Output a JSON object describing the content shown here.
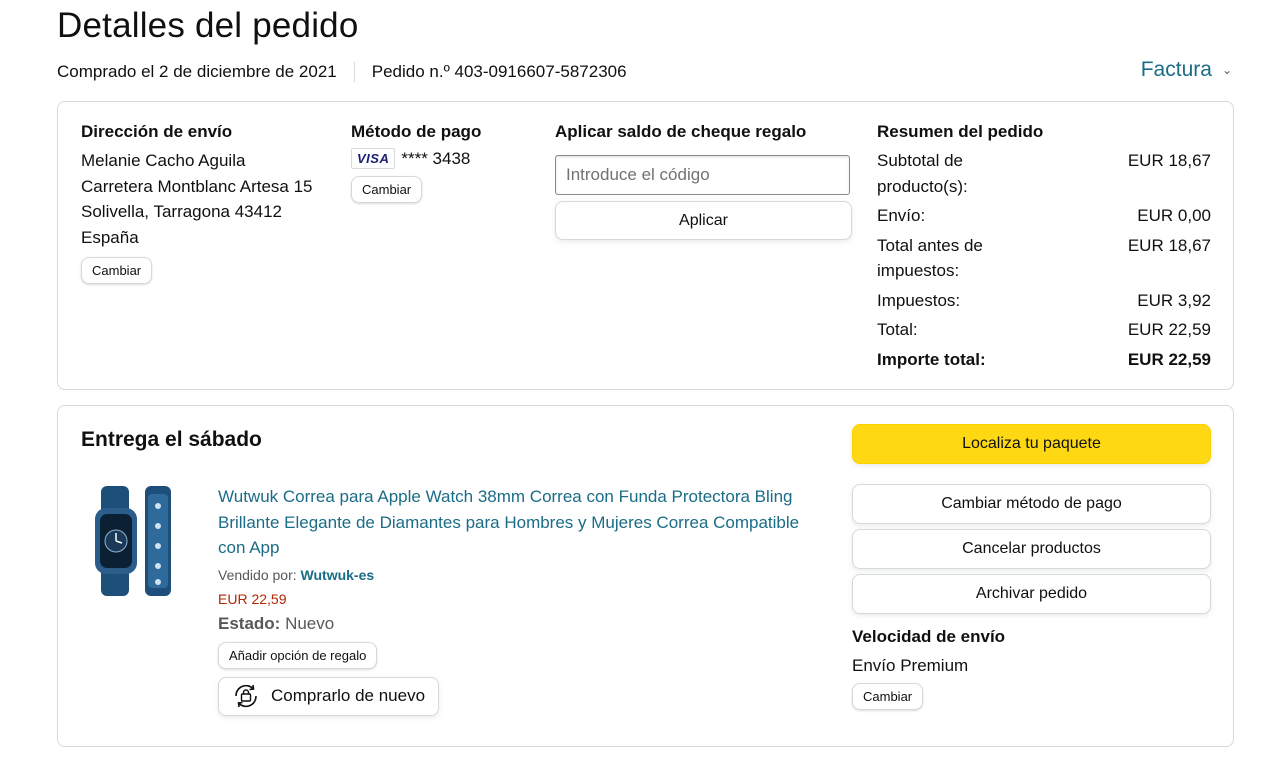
{
  "header": {
    "title": "Detalles del pedido",
    "purchased": "Comprado el 2 de diciembre de 2021",
    "order_number": "Pedido n.º 403-0916607-5872306",
    "invoice_label": "Factura"
  },
  "shipping_address": {
    "heading": "Dirección de envío",
    "lines": [
      "Melanie Cacho Aguila",
      "Carretera Montblanc Artesa 15",
      "Solivella, Tarragona 43412",
      "España"
    ],
    "change_label": "Cambiar"
  },
  "payment": {
    "heading": "Método de pago",
    "card_brand": "VISA",
    "card_number": "**** 3438",
    "change_label": "Cambiar"
  },
  "gift_card": {
    "heading": "Aplicar saldo de cheque regalo",
    "placeholder": "Introduce el código",
    "apply_label": "Aplicar"
  },
  "summary": {
    "heading": "Resumen del pedido",
    "rows": [
      {
        "label": "Subtotal de producto(s):",
        "value": "EUR 18,67"
      },
      {
        "label": "Envío:",
        "value": "EUR 0,00"
      },
      {
        "label": "Total antes de impuestos:",
        "value": "EUR 18,67"
      },
      {
        "label": "Impuestos:",
        "value": "EUR 3,92"
      },
      {
        "label": "Total:",
        "value": "EUR 22,59"
      }
    ],
    "grand_total_label": "Importe total:",
    "grand_total_value": "EUR 22,59"
  },
  "delivery": {
    "title": "Entrega el sábado",
    "product": {
      "title": "Wutwuk Correa para Apple Watch 38mm Correa con Funda Protectora Bling Brillante Elegante de Diamantes para Hombres y Mujeres Correa Compatible con App",
      "sold_by_label": "Vendido por:",
      "seller": "Wutwuk-es",
      "price": "EUR 22,59",
      "condition_label": "Estado:",
      "condition_value": "Nuevo",
      "gift_option_label": "Añadir opción de regalo",
      "buy_again_label": "Comprarlo de nuevo"
    },
    "actions": {
      "track": "Localiza tu paquete",
      "change_payment": "Cambiar método de pago",
      "cancel": "Cancelar productos",
      "archive": "Archivar pedido"
    },
    "shipping_speed": {
      "heading": "Velocidad de envío",
      "value": "Envío Premium",
      "change_label": "Cambiar"
    }
  },
  "colors": {
    "link": "#1a6c87",
    "price": "#b12704",
    "primary_button": "#ffd814",
    "border": "#d5d9d9"
  }
}
